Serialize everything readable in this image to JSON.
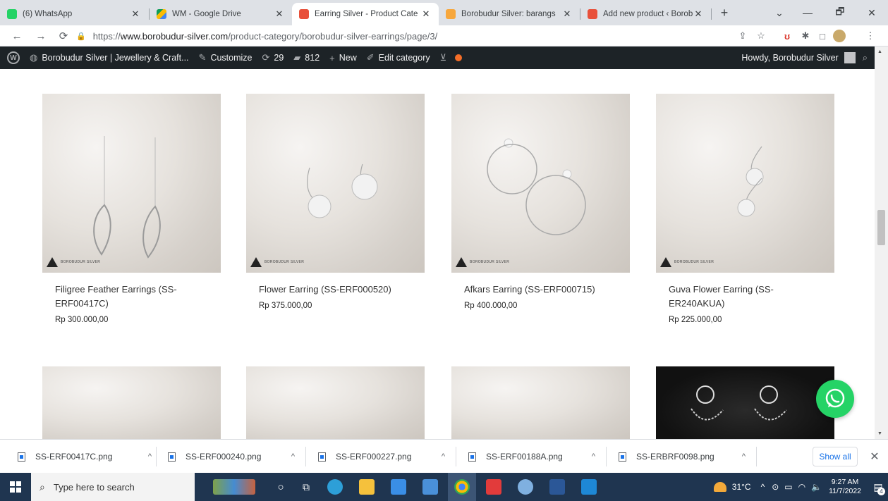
{
  "browser": {
    "tabs": [
      {
        "title": "(6) WhatsApp",
        "favicon_color": "#25d366",
        "active": false
      },
      {
        "title": "WM - Google Drive",
        "favicon_color": "#fbbc04",
        "active": false
      },
      {
        "title": "Earring Silver - Product Cate",
        "favicon_color": "#e8503a",
        "active": true
      },
      {
        "title": "Borobudur Silver: barangs",
        "favicon_color": "#f7a73c",
        "active": false
      },
      {
        "title": "Add new product ‹ Borobudu",
        "favicon_color": "#e8503a",
        "active": false
      }
    ],
    "new_tab_symbol": "+",
    "window_controls": {
      "list": "⌄",
      "minimize": "—",
      "maximize": "🗗",
      "close": "✕"
    },
    "url_prefix": "https://",
    "url_host": "www.borobudur-silver.com",
    "url_path": "/product-category/borobudur-silver-earrings/page/3/"
  },
  "adminbar": {
    "site_name": "Borobudur Silver | Jewellery & Craft...",
    "customize": "Customize",
    "updates": "29",
    "comments": "812",
    "new": "New",
    "edit_category": "Edit category",
    "greeting": "Howdy, Borobudur Silver"
  },
  "products": [
    {
      "name": "Filigree Feather Earrings (SS-ERF00417C)",
      "price": "Rp 300.000,00"
    },
    {
      "name": "Flower Earring (SS-ERF000520)",
      "price": "Rp 375.000,00"
    },
    {
      "name": "Afkars Earring (SS-ERF000715)",
      "price": "Rp 400.000,00"
    },
    {
      "name": "Guva Flower Earring (SS-ER240AKUA)",
      "price": "Rp 225.000,00"
    }
  ],
  "watermark": "BOROBUDUR SILVER",
  "downloads": {
    "files": [
      "SS-ERF00417C.png",
      "SS-ERF000240.png",
      "SS-ERF000227.png",
      "SS-ERF00188A.png",
      "SS-ERBRF0098.png"
    ],
    "show_all": "Show all"
  },
  "taskbar": {
    "search_placeholder": "Type here to search",
    "temperature": "31°C",
    "time": "9:27 AM",
    "date": "11/7/2022",
    "notifications": "4"
  }
}
